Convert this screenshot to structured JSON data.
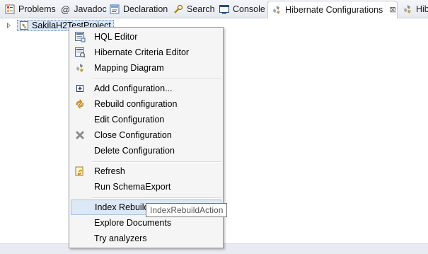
{
  "tabs": [
    {
      "label": "Problems",
      "icon": "problems-icon"
    },
    {
      "label": "Javadoc",
      "icon": "javadoc-icon",
      "prefix": "@"
    },
    {
      "label": "Declaration",
      "icon": "declaration-icon"
    },
    {
      "label": "Search",
      "icon": "search-icon"
    },
    {
      "label": "Console",
      "icon": "console-icon"
    },
    {
      "label": "Hibernate Configurations",
      "icon": "hibernate-icon",
      "close": "⊠"
    },
    {
      "label": "Hib",
      "icon": "hibernate-icon"
    }
  ],
  "tree": {
    "project_label": "SakilaH2TestProject"
  },
  "menu": {
    "items": [
      {
        "label": "HQL Editor",
        "icon": "hql-editor-icon"
      },
      {
        "label": "Hibernate Criteria Editor",
        "icon": "criteria-editor-icon"
      },
      {
        "label": "Mapping Diagram",
        "icon": "mapping-diagram-icon"
      },
      {
        "label": "Add Configuration...",
        "icon": "add-configuration-icon"
      },
      {
        "label": "Rebuild configuration",
        "icon": "rebuild-icon"
      },
      {
        "label": "Edit Configuration",
        "icon": ""
      },
      {
        "label": "Close Configuration",
        "icon": "close-icon"
      },
      {
        "label": "Delete Configuration",
        "icon": ""
      },
      {
        "label": "Refresh",
        "icon": "refresh-icon"
      },
      {
        "label": "Run SchemaExport",
        "icon": ""
      },
      {
        "label": "Index Rebuild",
        "icon": ""
      },
      {
        "label": "Explore Documents",
        "icon": ""
      },
      {
        "label": "Try analyzers",
        "icon": ""
      }
    ]
  },
  "tooltip": {
    "text": "IndexRebuildAction"
  },
  "colors": {
    "menu_bg": "#f5f5f5",
    "hover_bg": "#dde8f6",
    "selection_bg": "#dbe8f7"
  }
}
